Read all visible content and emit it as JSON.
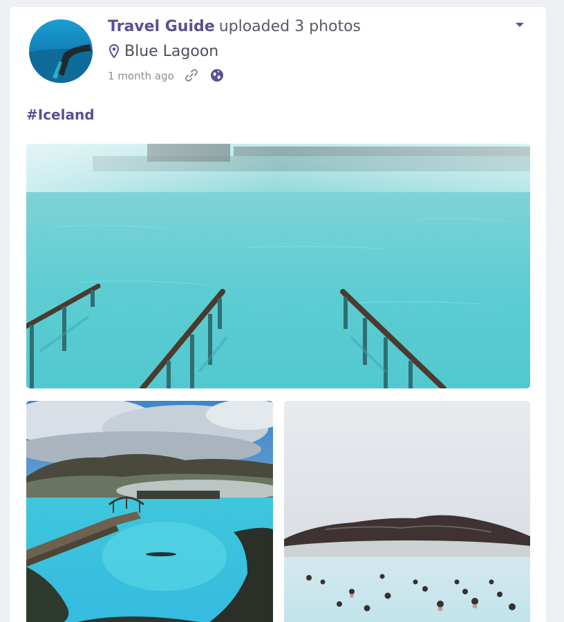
{
  "post": {
    "author": "Travel Guide",
    "action": "uploaded 3 photos",
    "location": "Blue Lagoon",
    "timestamp": "1 month ago",
    "privacy_icon": "globe-icon",
    "link_icon": "link-icon",
    "hashtag": "#Iceland",
    "photos": [
      {
        "subject": "Blue Lagoon steaming pool with wooden handrails"
      },
      {
        "subject": "Blue Lagoon bridge and mountains"
      },
      {
        "subject": "Bathers in misty Blue Lagoon"
      }
    ]
  },
  "colors": {
    "accent": "#5b4f95",
    "text_secondary": "#8a8f98",
    "lagoon": "#5ec8cf"
  }
}
